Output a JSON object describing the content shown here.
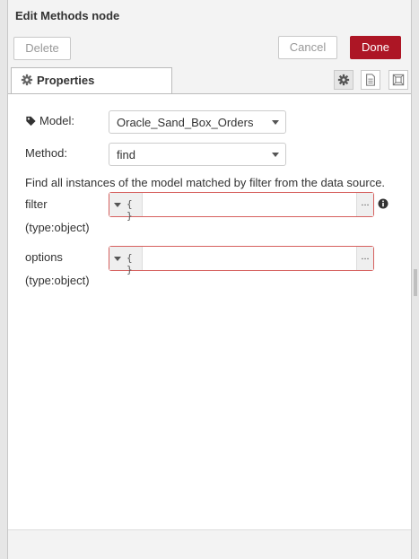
{
  "header": {
    "title": "Edit Methods node"
  },
  "toolbar": {
    "delete_label": "Delete",
    "cancel_label": "Cancel",
    "done_label": "Done"
  },
  "tabs": {
    "properties_label": "Properties"
  },
  "form": {
    "model_label": "Model:",
    "model_value": "Oracle_Sand_Box_Orders",
    "method_label": "Method:",
    "method_value": "find",
    "description": "Find all instances of the model matched by filter from the data source.",
    "filter_label": "filter",
    "filter_type": "(type:object)",
    "filter_type_glyph": "{ }",
    "options_label": "options",
    "options_type": "(type:object)",
    "options_type_glyph": "{ }",
    "ellipsis": "..."
  },
  "colors": {
    "done_button": "#ad1625",
    "invalid_border": "#d6615f"
  }
}
